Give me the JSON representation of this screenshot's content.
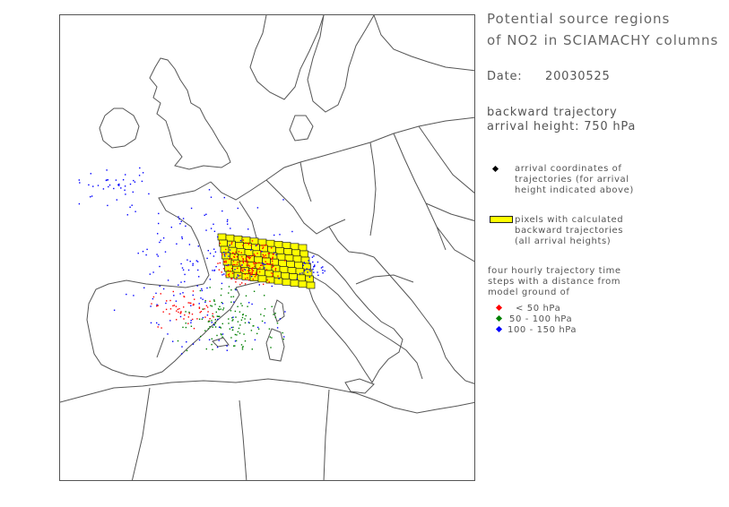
{
  "title_line1": "Potential source regions",
  "title_line2": "of NO2 in SCIAMACHY columns",
  "date_label": "Date:",
  "date_value": "20030525",
  "trajectory_line1": "backward trajectory",
  "trajectory_line2": "arrival height: 750 hPa",
  "legend": {
    "arrival_line1": "arrival coordinates of",
    "arrival_line2": "trajectories (for arrival",
    "arrival_line3": "height indicated above)",
    "pixels_line1": "pixels with calculated",
    "pixels_line2": "backward trajectories",
    "pixels_line3": "(all arrival heights)",
    "steps_line1": "four hourly trajectory time",
    "steps_line2": "steps with a distance from",
    "steps_line3": "model ground of",
    "classes": [
      {
        "label": "< 50 hPa",
        "color": "#ff0000"
      },
      {
        "label": "50 - 100 hPa",
        "color": "#008000"
      },
      {
        "label": "100 - 150 hPa",
        "color": "#0000ff"
      }
    ]
  },
  "colors": {
    "pixel_fill": "#ffff00",
    "arrival": "#000000",
    "coastline": "#555555"
  }
}
